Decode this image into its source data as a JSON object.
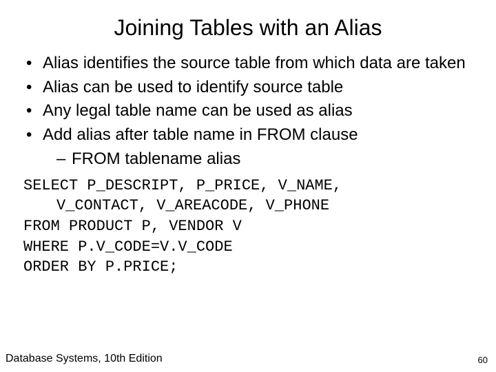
{
  "title": "Joining Tables with an Alias",
  "bullets": [
    {
      "text": "Alias identifies the source table from which data are taken"
    },
    {
      "text": "Alias can be used to identify source table"
    },
    {
      "text": "Any legal table name can be used as alias"
    },
    {
      "text": "Add alias after table name in FROM clause",
      "sub": [
        "FROM tablename alias"
      ]
    }
  ],
  "code": {
    "l1a": "SELECT P_DESCRIPT, P_PRICE, V_NAME,",
    "l1b": "V_CONTACT, V_AREACODE, V_PHONE",
    "l2": "FROM PRODUCT P, VENDOR V",
    "l3": "WHERE P.V_CODE=V.V_CODE",
    "l4": "ORDER BY P.PRICE;"
  },
  "footer_left": "Database Systems, 10th Edition",
  "footer_right": "60"
}
